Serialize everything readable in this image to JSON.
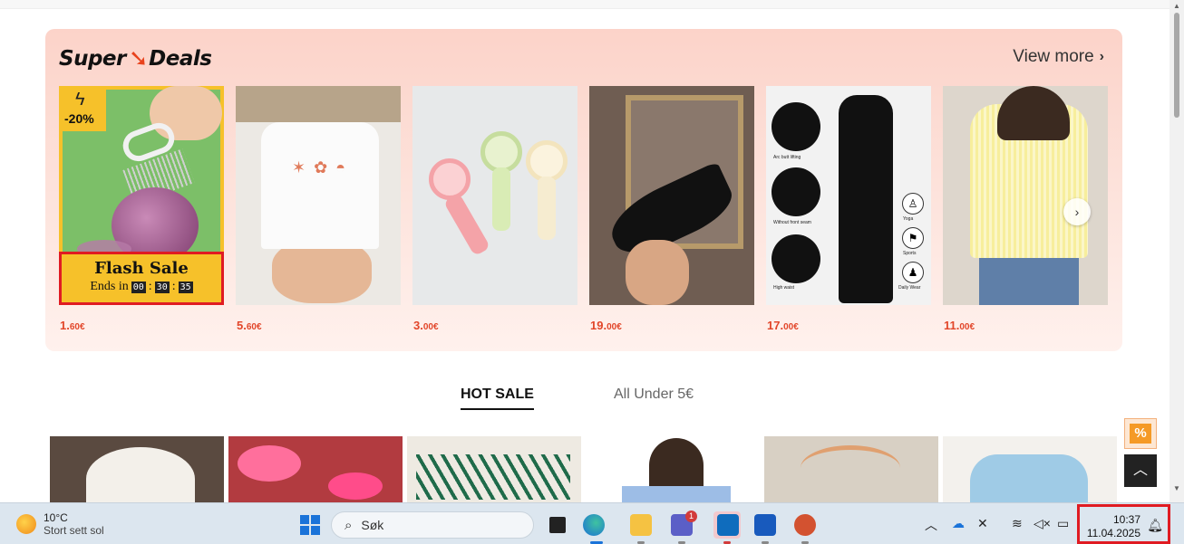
{
  "deals": {
    "logo_super": "Super",
    "logo_deals": "Deals",
    "view_more": "View more",
    "flash_badge": "-20%",
    "flash_title": "Flash Sale",
    "ends_in": "Ends in",
    "timer": [
      "00",
      "30",
      "35"
    ],
    "prices": [
      {
        "main": "1.",
        "cents": "60€"
      },
      {
        "main": "5.",
        "cents": "60€"
      },
      {
        "main": "3.",
        "cents": "00€"
      },
      {
        "main": "19.",
        "cents": "00€"
      },
      {
        "main": "17.",
        "cents": "00€"
      },
      {
        "main": "11.",
        "cents": "00€"
      }
    ],
    "leggings_labels": [
      "Arc butt lifting",
      "Without front seam",
      "High waist",
      "Yoga",
      "Sports",
      "Daily Wear"
    ]
  },
  "tabs": {
    "hot_sale": "HOT SALE",
    "all_under": "All Under 5€"
  },
  "fab": {
    "coupon": "%"
  },
  "taskbar": {
    "temp": "10°C",
    "weather": "Stort sett sol",
    "search_placeholder": "Søk",
    "teams_badge": "1",
    "time": "10:37",
    "date": "11.04.2025"
  },
  "colors": {
    "price": "#e2462a",
    "flash_bg": "#f6c12a",
    "highlight": "#e01b22",
    "taskbar": "#dce6ef"
  }
}
